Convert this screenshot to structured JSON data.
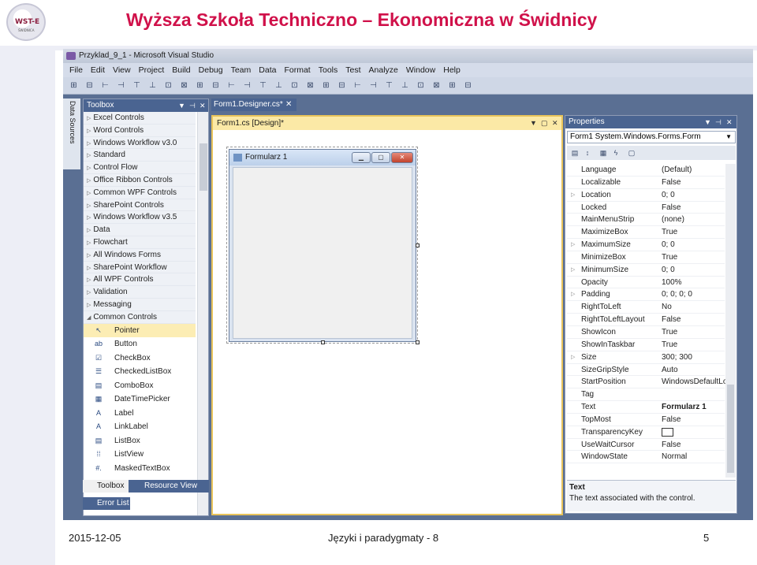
{
  "slide": {
    "title": "Wyższa Szkoła Techniczno – Ekonomiczna w Świdnicy",
    "logo_text": "WST-E",
    "logo_sub": "ŚWIDNICA",
    "footer_date": "2015-12-05",
    "footer_mid": "Języki i paradygmaty - 8",
    "page_number": "5"
  },
  "vs": {
    "title": "Przyklad_9_1 - Microsoft Visual Studio",
    "menu": [
      "File",
      "Edit",
      "View",
      "Project",
      "Build",
      "Debug",
      "Team",
      "Data",
      "Format",
      "Tools",
      "Test",
      "Analyze",
      "Window",
      "Help"
    ],
    "data_sources_tab": "Data Sources",
    "toolbox": {
      "title": "Toolbox",
      "categories": [
        "Excel Controls",
        "Word Controls",
        "Windows Workflow v3.0",
        "Standard",
        "Control Flow",
        "Office Ribbon Controls",
        "Common WPF Controls",
        "SharePoint Controls",
        "Windows Workflow v3.5",
        "Data",
        "Flowchart",
        "All Windows Forms",
        "SharePoint Workflow",
        "All WPF Controls",
        "Validation",
        "Messaging",
        "Common Controls"
      ],
      "items": [
        {
          "label": "Pointer",
          "icon": "pointer-icon",
          "glyph": "↖"
        },
        {
          "label": "Button",
          "icon": "button-icon",
          "glyph": "ab"
        },
        {
          "label": "CheckBox",
          "icon": "checkbox-icon",
          "glyph": "☑"
        },
        {
          "label": "CheckedListBox",
          "icon": "checkedlistbox-icon",
          "glyph": "☰"
        },
        {
          "label": "ComboBox",
          "icon": "combobox-icon",
          "glyph": "▤"
        },
        {
          "label": "DateTimePicker",
          "icon": "datetimepicker-icon",
          "glyph": "▦"
        },
        {
          "label": "Label",
          "icon": "label-icon",
          "glyph": "A"
        },
        {
          "label": "LinkLabel",
          "icon": "linklabel-icon",
          "glyph": "A"
        },
        {
          "label": "ListBox",
          "icon": "listbox-icon",
          "glyph": "▤"
        },
        {
          "label": "ListView",
          "icon": "listview-icon",
          "glyph": "⁞⁞"
        },
        {
          "label": "MaskedTextBox",
          "icon": "maskedtextbox-icon",
          "glyph": "#."
        }
      ],
      "selected_item": "Pointer"
    },
    "bottom_tabs": [
      "Toolbox",
      "Resource View"
    ],
    "error_list": "Error List",
    "doc_tab": "Form1.Designer.cs*",
    "designer_title": "Form1.cs [Design]*",
    "form": {
      "title": "Formularz 1"
    },
    "properties": {
      "title": "Properties",
      "object": "Form1  System.Windows.Forms.Form",
      "rows": [
        {
          "name": "Language",
          "value": "(Default)",
          "expandable": false
        },
        {
          "name": "Localizable",
          "value": "False",
          "expandable": false
        },
        {
          "name": "Location",
          "value": "0; 0",
          "expandable": true
        },
        {
          "name": "Locked",
          "value": "False",
          "expandable": false
        },
        {
          "name": "MainMenuStrip",
          "value": "(none)",
          "expandable": false
        },
        {
          "name": "MaximizeBox",
          "value": "True",
          "expandable": false
        },
        {
          "name": "MaximumSize",
          "value": "0; 0",
          "expandable": true
        },
        {
          "name": "MinimizeBox",
          "value": "True",
          "expandable": false
        },
        {
          "name": "MinimumSize",
          "value": "0; 0",
          "expandable": true
        },
        {
          "name": "Opacity",
          "value": "100%",
          "expandable": false
        },
        {
          "name": "Padding",
          "value": "0; 0; 0; 0",
          "expandable": true
        },
        {
          "name": "RightToLeft",
          "value": "No",
          "expandable": false
        },
        {
          "name": "RightToLeftLayout",
          "value": "False",
          "expandable": false
        },
        {
          "name": "ShowIcon",
          "value": "True",
          "expandable": false
        },
        {
          "name": "ShowInTaskbar",
          "value": "True",
          "expandable": false
        },
        {
          "name": "Size",
          "value": "300; 300",
          "expandable": true
        },
        {
          "name": "SizeGripStyle",
          "value": "Auto",
          "expandable": false
        },
        {
          "name": "StartPosition",
          "value": "WindowsDefaultLo",
          "expandable": false
        },
        {
          "name": "Tag",
          "value": "",
          "expandable": false
        },
        {
          "name": "Text",
          "value": "Formularz 1",
          "expandable": false
        },
        {
          "name": "TopMost",
          "value": "False",
          "expandable": false
        },
        {
          "name": "TransparencyKey",
          "value": "",
          "expandable": false
        },
        {
          "name": "UseWaitCursor",
          "value": "False",
          "expandable": false
        },
        {
          "name": "WindowState",
          "value": "Normal",
          "expandable": false
        }
      ],
      "selected_row": "Text",
      "desc_title": "Text",
      "desc_text": "The text associated with the control."
    }
  }
}
